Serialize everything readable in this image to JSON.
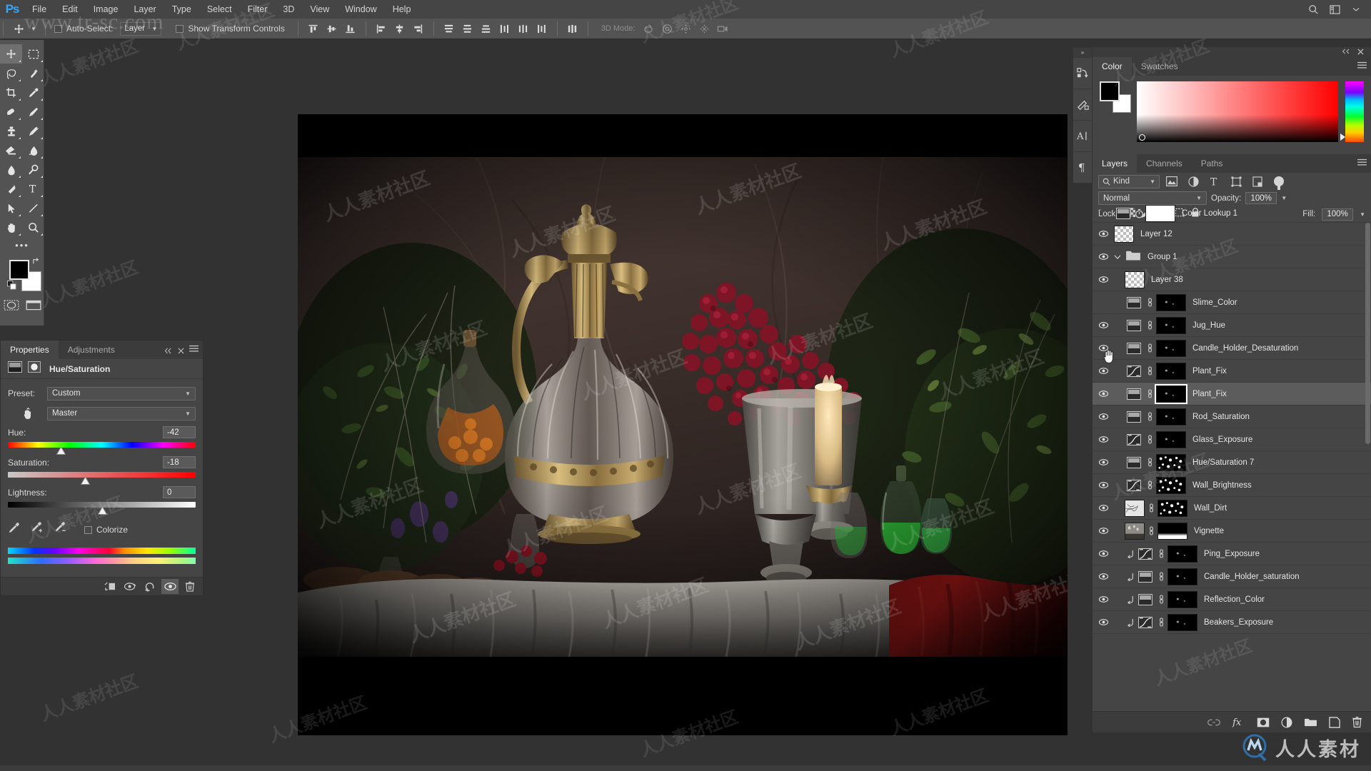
{
  "app": {
    "logo": "Ps"
  },
  "menubar": {
    "items": [
      "File",
      "Edit",
      "Image",
      "Layer",
      "Type",
      "Select",
      "Filter",
      "3D",
      "View",
      "Window",
      "Help"
    ],
    "right_icons": [
      "search-icon",
      "workspace-icon",
      "chevron-down-icon"
    ]
  },
  "optionsbar": {
    "tool_icon": "move-tool-icon",
    "auto_select_label": "Auto-Select:",
    "auto_select_value": "Layer",
    "show_transform_label": "Show Transform Controls",
    "three_d_mode_label": "3D Mode:",
    "align_icons": [
      "align-top-edges-icon",
      "align-vertical-centers-icon",
      "align-bottom-edges-icon",
      "align-left-edges-icon",
      "align-horizontal-centers-icon",
      "align-right-edges-icon"
    ],
    "distribute_icons": [
      "distribute-top-edges-icon",
      "distribute-vertical-centers-icon",
      "distribute-bottom-edges-icon",
      "distribute-left-edges-icon",
      "distribute-horizontal-centers-icon",
      "distribute-right-edges-icon"
    ],
    "extra_icons": [
      "auto-align-icon"
    ],
    "three_d_icons": [
      "3d-rotate-icon",
      "3d-roll-icon",
      "3d-pan-icon",
      "3d-slide-icon",
      "3d-scale-icon"
    ]
  },
  "toolbar": {
    "tools": [
      {
        "name": "move-tool-icon",
        "selected": true
      },
      {
        "name": "rectangular-marquee-tool-icon",
        "selected": false
      },
      {
        "name": "lasso-tool-icon",
        "selected": false
      },
      {
        "name": "quick-selection-tool-icon",
        "selected": false
      },
      {
        "name": "crop-tool-icon",
        "selected": false
      },
      {
        "name": "eyedropper-tool-icon",
        "selected": false
      },
      {
        "name": "spot-healing-brush-tool-icon",
        "selected": false
      },
      {
        "name": "brush-tool-icon",
        "selected": false
      },
      {
        "name": "clone-stamp-tool-icon",
        "selected": false
      },
      {
        "name": "history-brush-tool-icon",
        "selected": false
      },
      {
        "name": "eraser-tool-icon",
        "selected": false
      },
      {
        "name": "gradient-tool-icon",
        "selected": false
      },
      {
        "name": "blur-tool-icon",
        "selected": false
      },
      {
        "name": "dodge-tool-icon",
        "selected": false
      },
      {
        "name": "pen-tool-icon",
        "selected": false
      },
      {
        "name": "type-tool-icon",
        "selected": false
      },
      {
        "name": "path-selection-tool-icon",
        "selected": false
      },
      {
        "name": "line-tool-icon",
        "selected": false
      },
      {
        "name": "hand-tool-icon",
        "selected": false
      },
      {
        "name": "zoom-tool-icon",
        "selected": false
      }
    ],
    "more_tools": "edit-toolbar-icon",
    "foreground_color": "#000000",
    "background_color": "#ffffff",
    "quickmask_icon": "quick-mask-icon",
    "screenmode_icon": "screen-mode-icon"
  },
  "properties_panel": {
    "tabs": [
      {
        "label": "Properties",
        "active": true
      },
      {
        "label": "Adjustments",
        "active": false
      }
    ],
    "title": "Hue/Saturation",
    "preset_label": "Preset:",
    "preset_value": "Custom",
    "channel_value": "Master",
    "sliders": [
      {
        "label": "Hue:",
        "value": "-42",
        "pos_pct": 28
      },
      {
        "label": "Saturation:",
        "value": "-18",
        "pos_pct": 41
      },
      {
        "label": "Lightness:",
        "value": "0",
        "pos_pct": 50
      }
    ],
    "colorize_label": "Colorize",
    "colorize_checked": false,
    "footer_icons": [
      "clip-to-layer-icon",
      "view-previous-state-icon",
      "reset-icon",
      "toggle-visibility-icon",
      "delete-icon"
    ]
  },
  "vertical_dock": {
    "collapse_icon": "expand-panels-icon",
    "items": [
      "history-icon",
      "brush-settings-icon",
      "character-icon",
      "paragraph-icon"
    ]
  },
  "color_panel": {
    "tabs": [
      {
        "label": "Color",
        "active": true
      },
      {
        "label": "Swatches",
        "active": false
      }
    ],
    "foreground": "#000000",
    "background": "#ffffff",
    "menu_icon": "panel-menu-icon",
    "collapse_icon": "collapse-to-icons-icon",
    "close_icon": "close-icon"
  },
  "layers_panel": {
    "tabs": [
      {
        "label": "Layers",
        "active": true
      },
      {
        "label": "Channels",
        "active": false
      },
      {
        "label": "Paths",
        "active": false
      }
    ],
    "filter_kind_label": "Kind",
    "filter_icons": [
      "filter-pixel-icon",
      "filter-adjustment-icon",
      "filter-type-icon",
      "filter-shape-icon",
      "filter-smart-object-icon"
    ],
    "filter_toggle": "filter-enable-toggle",
    "blend_mode": "Normal",
    "opacity_label": "Opacity:",
    "opacity_value": "100%",
    "lock_label": "Lock:",
    "lock_icons": [
      "lock-transparent-pixels-icon",
      "lock-image-pixels-icon",
      "lock-position-icon",
      "lock-artboard-icon",
      "lock-all-icon"
    ],
    "fill_label": "Fill:",
    "fill_value": "100%",
    "footer_icons": [
      "link-layers-icon",
      "add-layer-style-icon",
      "add-layer-mask-icon",
      "new-adjustment-layer-icon",
      "new-group-icon",
      "new-layer-icon",
      "delete-layer-icon"
    ],
    "layers": [
      {
        "name": "Color Lookup 1",
        "type": "adjustment",
        "visible": false,
        "indent": 0,
        "has_mask": true,
        "mask": "white",
        "linked": false,
        "clipped": false,
        "selected": false,
        "partial": true
      },
      {
        "name": "Layer 12",
        "type": "pixel",
        "visible": true,
        "indent": 0,
        "has_mask": false,
        "linked": false,
        "clipped": false,
        "selected": false
      },
      {
        "name": "Group 1",
        "type": "group",
        "visible": true,
        "indent": 0,
        "has_mask": false,
        "linked": false,
        "clipped": false,
        "selected": false
      },
      {
        "name": "Layer 38",
        "type": "pixel",
        "visible": true,
        "indent": 1,
        "has_mask": false,
        "linked": false,
        "clipped": false,
        "selected": false
      },
      {
        "name": "Slime_Color",
        "type": "hue-saturation",
        "visible": false,
        "indent": 1,
        "has_mask": true,
        "mask": "black",
        "linked": true,
        "clipped": false,
        "selected": false
      },
      {
        "name": "Jug_Hue",
        "type": "hue-saturation",
        "visible": true,
        "indent": 1,
        "has_mask": true,
        "mask": "black",
        "linked": true,
        "clipped": false,
        "selected": false
      },
      {
        "name": "Candle_Holder_Desaturation",
        "type": "hue-saturation",
        "visible": true,
        "indent": 1,
        "has_mask": true,
        "mask": "black",
        "linked": true,
        "clipped": false,
        "selected": false
      },
      {
        "name": "Plant_Fix",
        "type": "curves",
        "visible": true,
        "indent": 1,
        "has_mask": true,
        "mask": "black",
        "linked": true,
        "clipped": false,
        "selected": false
      },
      {
        "name": "Plant_Fix",
        "type": "hue-saturation",
        "visible": true,
        "indent": 1,
        "has_mask": true,
        "mask": "black",
        "linked": true,
        "clipped": false,
        "selected": true
      },
      {
        "name": "Rod_Saturation",
        "type": "hue-saturation",
        "visible": true,
        "indent": 1,
        "has_mask": true,
        "mask": "black",
        "linked": true,
        "clipped": false,
        "selected": false
      },
      {
        "name": "Glass_Exposure",
        "type": "curves",
        "visible": true,
        "indent": 1,
        "has_mask": true,
        "mask": "black",
        "linked": true,
        "clipped": false,
        "selected": false
      },
      {
        "name": "Hue/Saturation 7",
        "type": "hue-saturation",
        "visible": true,
        "indent": 1,
        "has_mask": true,
        "mask": "speckle",
        "linked": true,
        "clipped": false,
        "selected": false
      },
      {
        "name": "Wall_Brightness",
        "type": "curves",
        "visible": true,
        "indent": 1,
        "has_mask": true,
        "mask": "speckle",
        "linked": true,
        "clipped": false,
        "selected": false
      },
      {
        "name": "Wall_Dirt",
        "type": "pixel",
        "visible": true,
        "indent": 1,
        "has_mask": true,
        "mask": "speckle",
        "linked": true,
        "clipped": false,
        "selected": false
      },
      {
        "name": "Vignette",
        "type": "pixel",
        "visible": true,
        "indent": 1,
        "has_mask": true,
        "mask": "gradient",
        "linked": true,
        "clipped": false,
        "selected": false
      },
      {
        "name": "Ping_Exposure",
        "type": "curves",
        "visible": true,
        "indent": 1,
        "has_mask": true,
        "mask": "black",
        "linked": true,
        "clipped": true,
        "selected": false
      },
      {
        "name": "Candle_Holder_saturation",
        "type": "hue-saturation",
        "visible": true,
        "indent": 1,
        "has_mask": true,
        "mask": "black",
        "linked": true,
        "clipped": true,
        "selected": false
      },
      {
        "name": "Reflection_Color",
        "type": "hue-saturation",
        "visible": true,
        "indent": 1,
        "has_mask": true,
        "mask": "black",
        "linked": true,
        "clipped": true,
        "selected": false
      },
      {
        "name": "Beakers_Exposure",
        "type": "curves",
        "visible": true,
        "indent": 1,
        "has_mask": true,
        "mask": "black",
        "linked": true,
        "clipped": true,
        "selected": false
      }
    ]
  },
  "watermarks": {
    "url": "www.tr-sc.com",
    "brand_text": "人人素材",
    "tile_text": "人人素材社区"
  },
  "document": {
    "description": "Dark still-life photograph: ornate glass and brass jug, red berry cluster, lit candle in silver holder, green glass beakers, white linen tablecloth, red velvet drape, stone wall background"
  }
}
